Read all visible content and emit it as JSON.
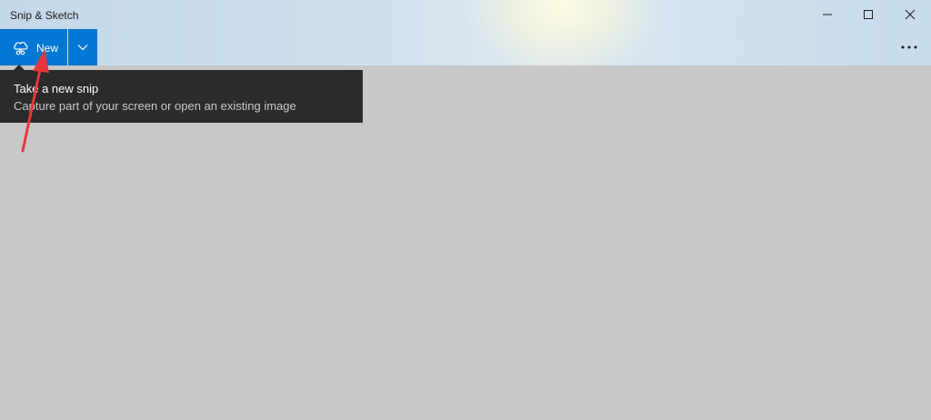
{
  "window": {
    "title": "Snip & Sketch",
    "controls": {
      "minimize_icon": "minimize-icon",
      "maximize_icon": "maximize-icon",
      "close_icon": "close-icon"
    }
  },
  "toolbar": {
    "new_label": "New",
    "new_icon": "snip-icon",
    "dropdown_icon": "chevron-down-icon",
    "more_icon": "more-icon"
  },
  "tooltip": {
    "title": "Take a new snip",
    "description": "Capture part of your screen or open an existing image"
  },
  "colors": {
    "accent": "#0078d4",
    "tooltip_bg": "#2b2b2b",
    "canvas_bg": "#c8c8c8",
    "annotation": "#e8383d"
  }
}
